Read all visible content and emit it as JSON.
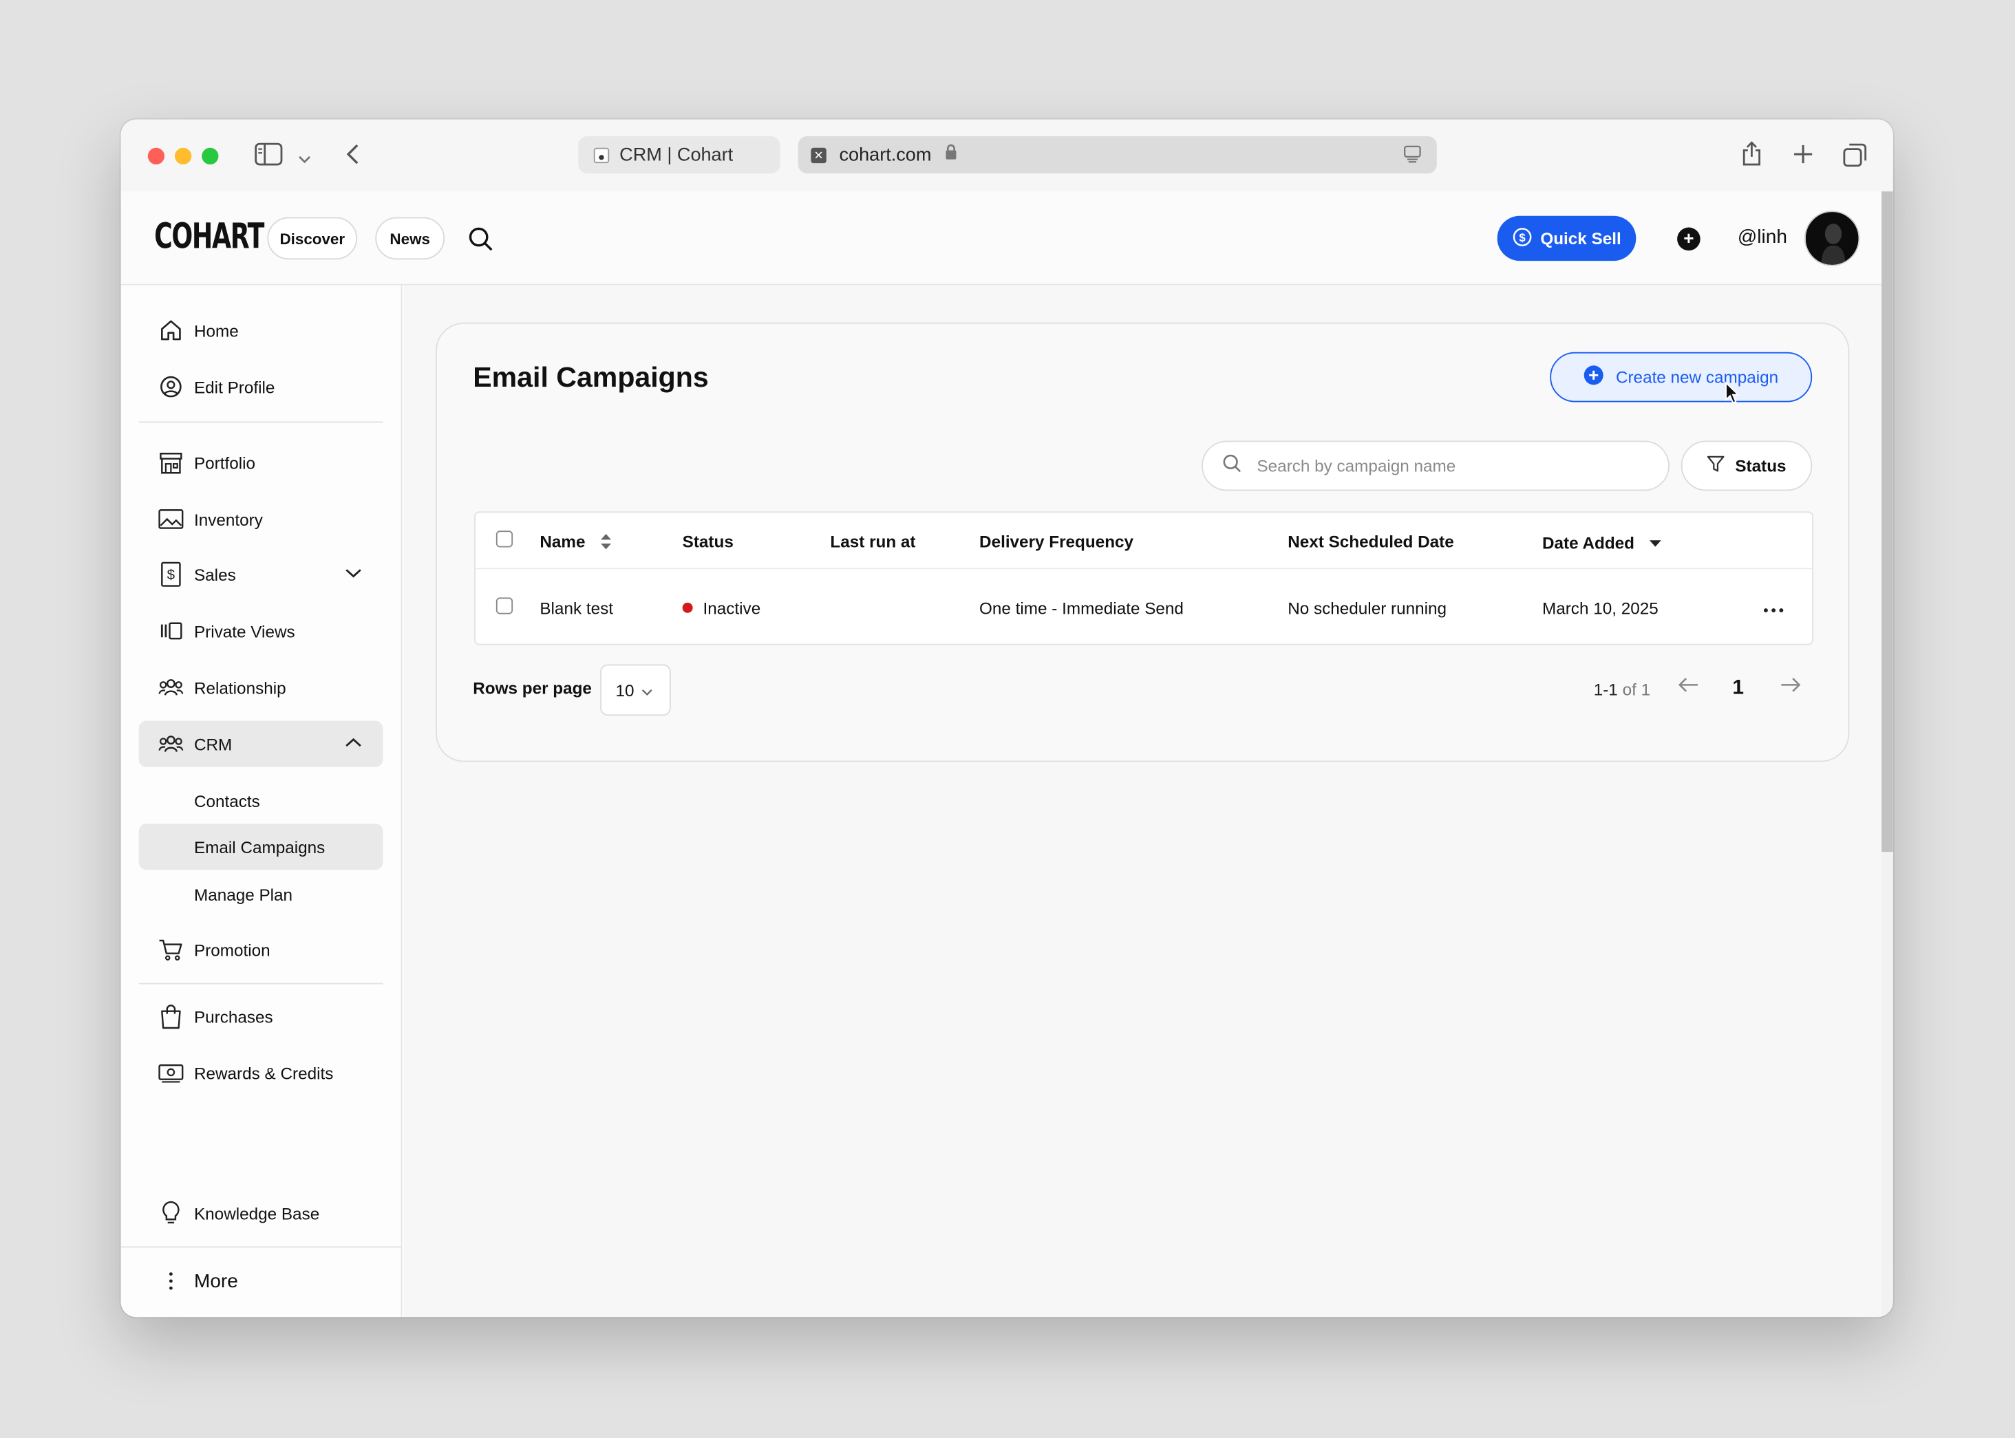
{
  "browser": {
    "tab_title": "CRM | Cohart",
    "address": "cohart.com"
  },
  "header": {
    "logo": "COHART",
    "discover_label": "Discover",
    "news_label": "News",
    "quick_sell_label": "Quick Sell",
    "username": "@linh",
    "accent_color": "#1a5cf0"
  },
  "sidebar": {
    "home": "Home",
    "edit_profile": "Edit Profile",
    "portfolio": "Portfolio",
    "inventory": "Inventory",
    "sales": "Sales",
    "private_views": "Private Views",
    "relationship": "Relationship",
    "crm": "CRM",
    "contacts": "Contacts",
    "email_campaigns": "Email Campaigns",
    "manage_plan": "Manage Plan",
    "promotion": "Promotion",
    "purchases": "Purchases",
    "rewards_credits": "Rewards & Credits",
    "knowledge_base": "Knowledge Base",
    "more": "More"
  },
  "main": {
    "title": "Email Campaigns",
    "create_button": "Create new campaign",
    "search_placeholder": "Search by campaign name",
    "status_filter": "Status",
    "table": {
      "headers": {
        "name": "Name",
        "status": "Status",
        "last_run": "Last run at",
        "delivery": "Delivery Frequency",
        "next": "Next Scheduled Date",
        "date_added": "Date Added"
      },
      "rows": [
        {
          "name": "Blank test",
          "status": "Inactive",
          "last_run": "",
          "delivery": "One time - Immediate Send",
          "next": "No scheduler running",
          "date_added": "March 10, 2025"
        }
      ]
    },
    "pagination": {
      "rows_per_page_label": "Rows per page",
      "rows_per_page_value": "10",
      "range_start": "1-1",
      "range_of": "of 1",
      "current_page": "1"
    }
  }
}
